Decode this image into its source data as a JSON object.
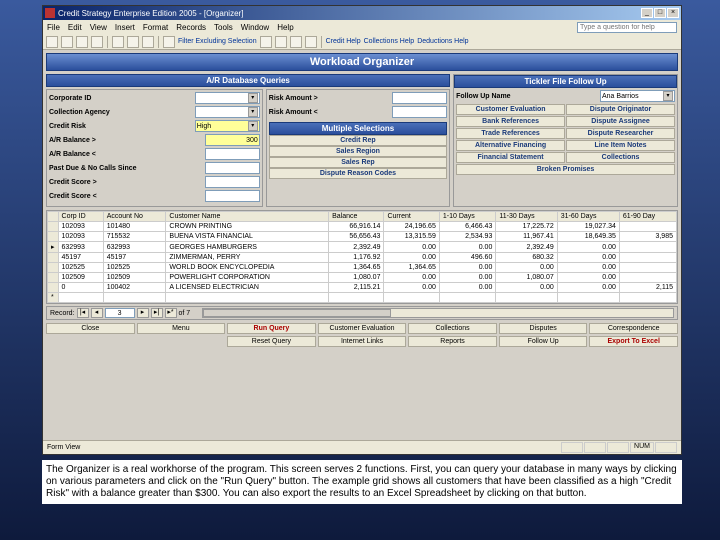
{
  "title": "Credit Strategy Enterprise Edition 2005 - [Organizer]",
  "menubar": [
    "File",
    "Edit",
    "View",
    "Insert",
    "Format",
    "Records",
    "Tools",
    "Window",
    "Help"
  ],
  "help_placeholder": "Type a question for help",
  "toolbar_links": [
    "Filter Excluding Selection",
    "Credit Help",
    "Collections Help",
    "Deductions Help"
  ],
  "header": "Workload Organizer",
  "sections": {
    "left": "A/R Database Queries",
    "right": "Tickler File Follow Up",
    "multi": "Multiple Selections"
  },
  "left_fields": {
    "corp_id": "Corporate ID",
    "agency": "Collection Agency",
    "risk": "Credit Risk",
    "risk_val": "High",
    "bal_gt": "A/R Balance >",
    "bal_gt_val": "300",
    "bal_lt": "A/R Balance <",
    "past_due": "Past Due & No Calls Since",
    "score_gt": "Credit Score >",
    "score_lt": "Credit Score <"
  },
  "mid_fields": {
    "amt_gt": "Risk Amount >",
    "amt_lt": "Risk Amount <"
  },
  "multi_btns": [
    "Credit Rep",
    "Sales Region",
    "Sales Rep",
    "Dispute Reason Codes"
  ],
  "right_fields": {
    "followup": "Follow Up Name",
    "followup_val": "Ana Barrios"
  },
  "tickler_btns": [
    "Customer Evaluation",
    "Dispute Originator",
    "Bank References",
    "Dispute Assignee",
    "Trade References",
    "Dispute Researcher",
    "Alternative Financing",
    "Line Item Notes",
    "Financial Statement",
    "Collections",
    "Broken Promises"
  ],
  "grid_headers": [
    "Corp ID",
    "Account No",
    "Customer Name",
    "Balance",
    "Current",
    "1-10 Days",
    "11-30 Days",
    "31-60 Days",
    "61-90 Day"
  ],
  "grid_rows": [
    [
      "102093",
      "101480",
      "CROWN PRINTING",
      "66,916.14",
      "24,196.65",
      "6,466.43",
      "17,225.72",
      "19,027.34",
      ""
    ],
    [
      "102093",
      "715532",
      "BUENA VISTA FINANCIAL",
      "56,656.43",
      "13,315.59",
      "2,534.93",
      "11,967.41",
      "18,649.35",
      "3,985"
    ],
    [
      "632993",
      "632993",
      "GEORGES HAMBURGERS",
      "2,392.49",
      "0.00",
      "0.00",
      "2,392.49",
      "0.00",
      ""
    ],
    [
      "45197",
      "45197",
      "ZIMMERMAN, PERRY",
      "1,176.92",
      "0.00",
      "496.60",
      "680.32",
      "0.00",
      ""
    ],
    [
      "102525",
      "102525",
      "WORLD BOOK ENCYCLOPEDIA",
      "1,364.65",
      "1,364.65",
      "0.00",
      "0.00",
      "0.00",
      ""
    ],
    [
      "102509",
      "102509",
      "POWERLIGHT CORPORATION",
      "1,080.07",
      "0.00",
      "0.00",
      "1,080.07",
      "0.00",
      ""
    ],
    [
      "0",
      "100402",
      "A LICENSED ELECTRICIAN",
      "2,115.21",
      "0.00",
      "0.00",
      "0.00",
      "0.00",
      "2,115"
    ]
  ],
  "record": {
    "label": "Record:",
    "pos": "3",
    "of": "of  7"
  },
  "actions": {
    "r1": [
      "Close",
      "Menu",
      "Run Query",
      "Customer Evaluation",
      "Collections",
      "Disputes",
      "Correspondence"
    ],
    "r2": [
      "",
      "",
      "Reset Query",
      "Internet Links",
      "Reports",
      "Follow Up",
      "Export To Excel"
    ]
  },
  "status": {
    "left": "Form View",
    "num": "NUM"
  },
  "caption": "The Organizer is a real workhorse of the program. This screen serves 2 functions. First, you can query your database in many ways by clicking on various parameters and click on the \"Run Query\" button. The example grid shows all customers that have been classified as a high \"Credit Risk\" with a balance greater than $300. You can also export the results to an Excel Spreadsheet by clicking on that button."
}
